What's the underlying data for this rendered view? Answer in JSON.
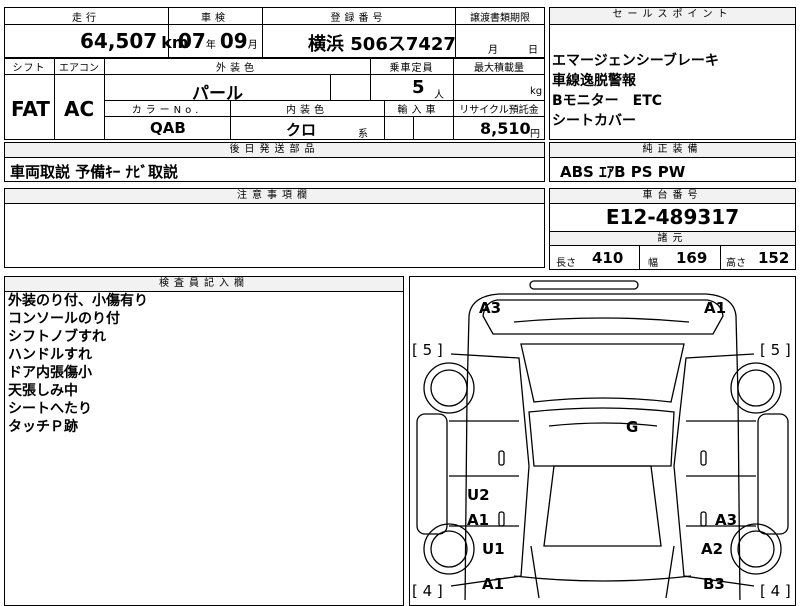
{
  "header": {
    "mileage_label": "走行",
    "shaken_label": "車検",
    "reg_label": "登録番号",
    "doc_label": "譲渡書類期限",
    "sales_label": "セールスポイント"
  },
  "values": {
    "mileage": "64,507",
    "mileage_unit": "km",
    "shaken_year": "07",
    "shaken_year_unit": "年",
    "shaken_month": "09",
    "shaken_month_unit": "月",
    "reg_number": "横浜 506ス7427",
    "doc_month_unit": "月",
    "doc_day_unit": "日"
  },
  "row2": {
    "shift_label": "シフト",
    "ac_label": "エアコン",
    "exterior_label": "外装色",
    "capacity_label": "乗車定員",
    "max_load_label": "最大積載量",
    "shift": "FAT",
    "ac": "AC",
    "exterior_color": "パール",
    "capacity": "5",
    "capacity_unit": "人",
    "load_unit": "kg",
    "color_no_label": "カラーNo.",
    "interior_label": "内装色",
    "import_label": "輸入車",
    "recycle_label": "リサイクル預託金",
    "color_no": "QAB",
    "interior": "クロ",
    "interior_unit": "系",
    "recycle": "8,510",
    "recycle_unit": "円"
  },
  "sales_points": [
    "エマージェンシーブレーキ",
    "車線逸脱警報",
    "Bモニター　ETC",
    "シートカバー"
  ],
  "later_parts": {
    "label": "後日発送部品",
    "text": "車両取説 予備ｷｰ ﾅﾋﾞ取説"
  },
  "equipment": {
    "label": "純正装備",
    "text": "ABS ｴｱB PS PW"
  },
  "notes": {
    "label": "注意事項欄"
  },
  "chassis": {
    "label": "車台番号",
    "value": "E12-489317"
  },
  "dimensions": {
    "label": "諸元",
    "length_label": "長さ",
    "length": "410",
    "width_label": "幅",
    "width": "169",
    "height_label": "高さ",
    "height": "152"
  },
  "inspector": {
    "label": "検査員記入欄",
    "lines": [
      "外装のり付、小傷有り",
      "コンソールのり付",
      "シフトノブすれ",
      "ハンドルすれ",
      "ドア内張傷小",
      "天張しみ中",
      "シートへたり",
      "タッチＰ跡"
    ]
  },
  "diagram": {
    "tire_fl": "[ 5 ]",
    "tire_fr": "[ 5 ]",
    "tire_rl": "[ 4 ]",
    "tire_rr": "[ 4 ]",
    "marks": {
      "A3_top": "A3",
      "A1_top": "A1",
      "G": "G",
      "U2": "U2",
      "A1_left_mid": "A1",
      "A3_right": "A3",
      "U1": "U1",
      "A2": "A2",
      "A1_left_low": "A1",
      "B3": "B3"
    }
  }
}
